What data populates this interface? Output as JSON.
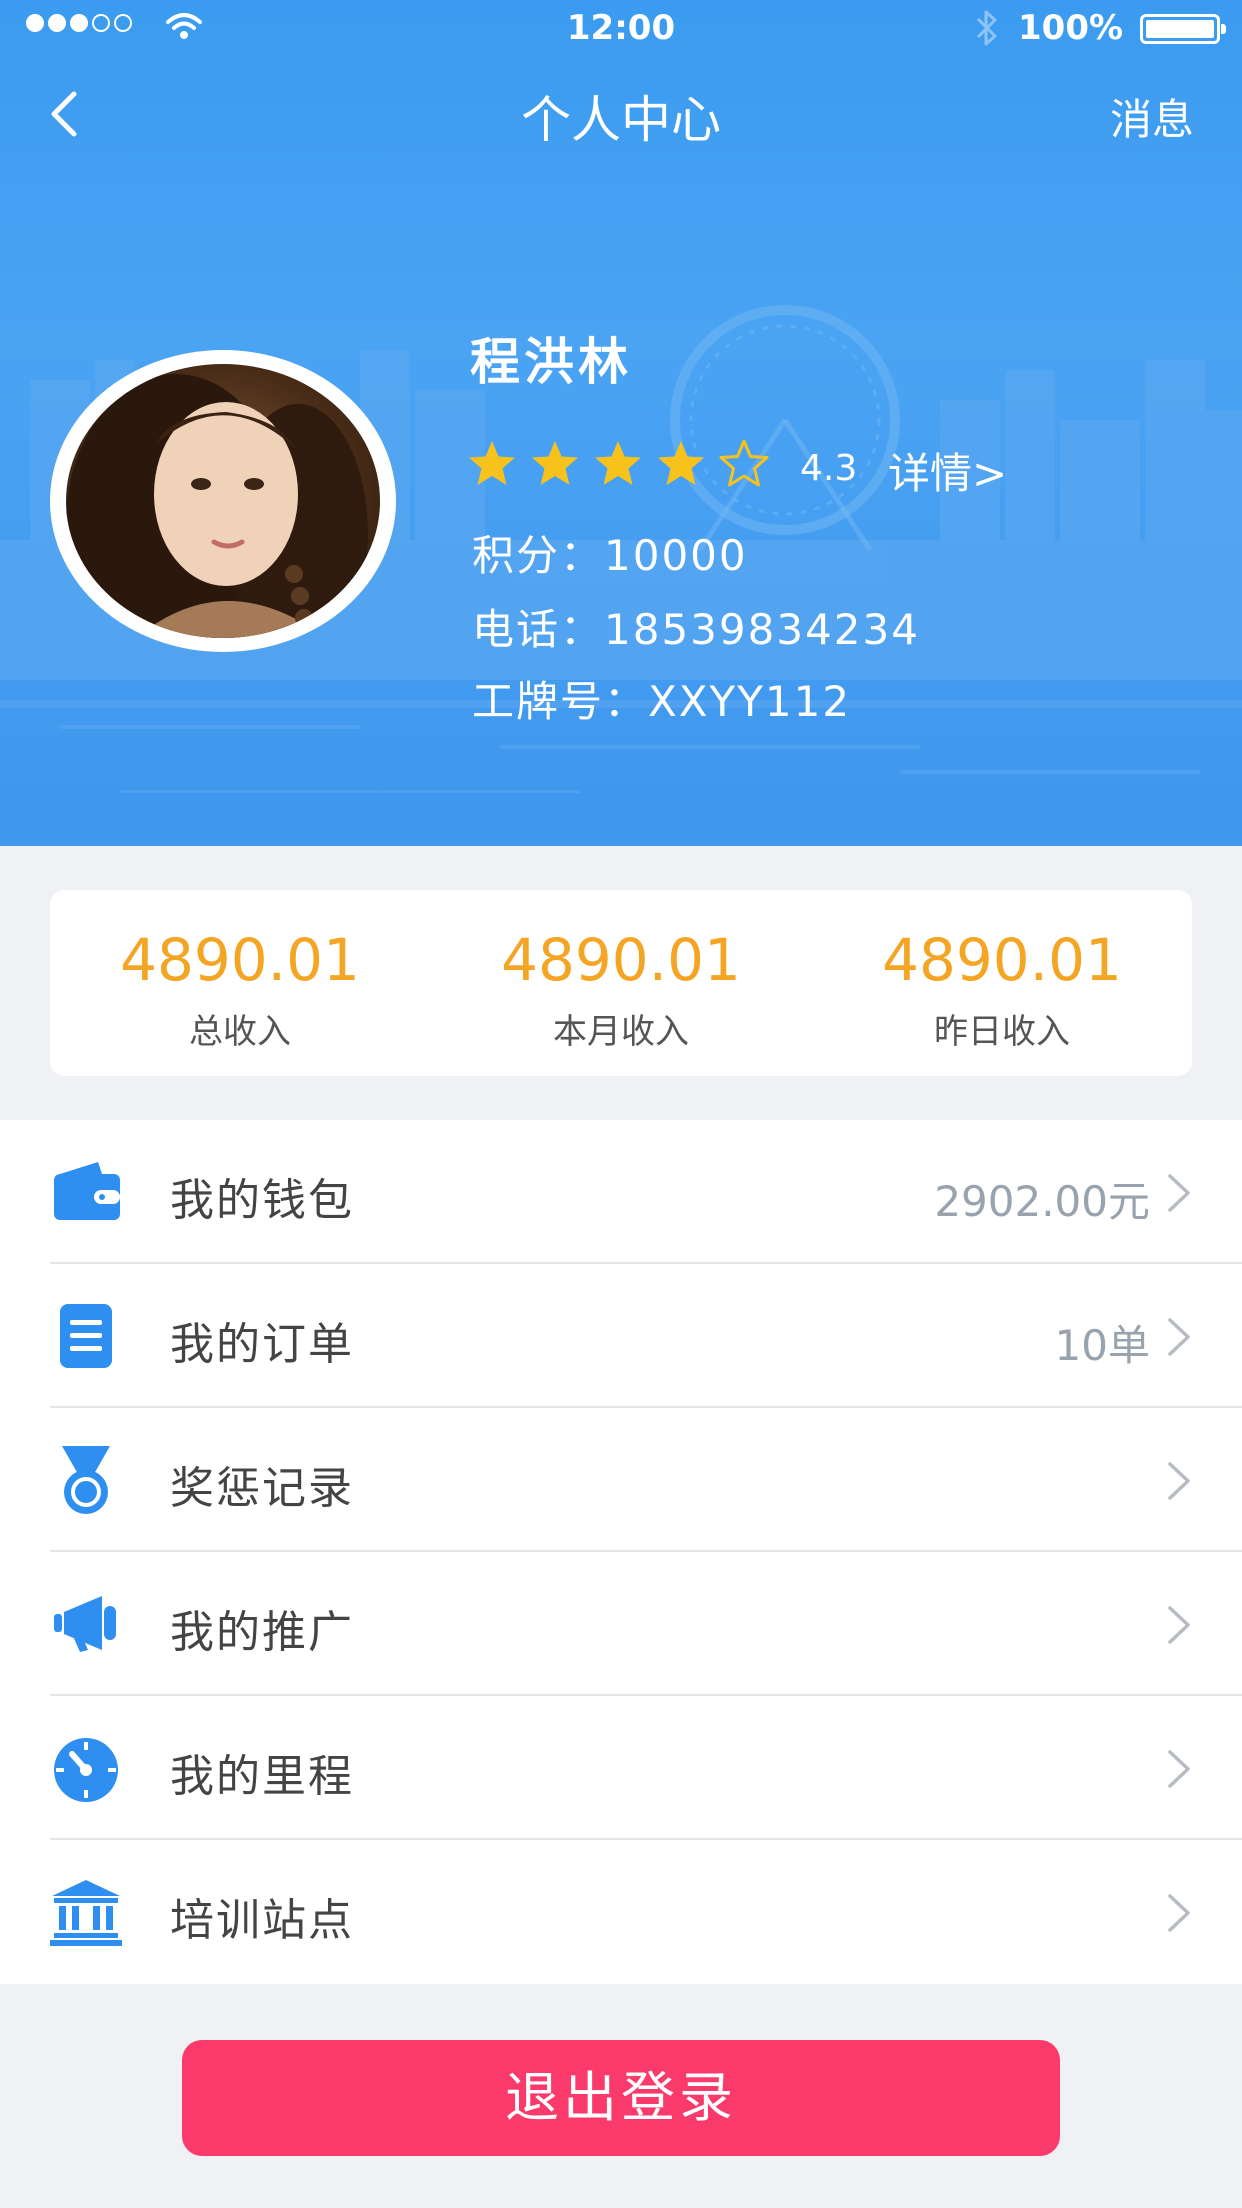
{
  "status_bar": {
    "time": "12:00",
    "battery": "100%"
  },
  "nav": {
    "title": "个人中心",
    "message": "消息"
  },
  "profile": {
    "name": "程洪林",
    "rating": "4.3",
    "rating_stars": 4,
    "rating_max": 5,
    "detail_link": "详情>",
    "points_label": "积分：",
    "points_value": "10000",
    "phone_label": "电话：",
    "phone_value": "18539834234",
    "badge_label": "工牌号：",
    "badge_value": "XXYY112"
  },
  "income": [
    {
      "value": "4890.01",
      "label": "总收入"
    },
    {
      "value": "4890.01",
      "label": "本月收入"
    },
    {
      "value": "4890.01",
      "label": "昨日收入"
    }
  ],
  "menu": [
    {
      "icon": "wallet-icon",
      "label": "我的钱包",
      "value": "2902.00元"
    },
    {
      "icon": "order-list-icon",
      "label": "我的订单",
      "value": "10单"
    },
    {
      "icon": "medal-icon",
      "label": "奖惩记录",
      "value": ""
    },
    {
      "icon": "megaphone-icon",
      "label": "我的推广",
      "value": ""
    },
    {
      "icon": "speedometer-icon",
      "label": "我的里程",
      "value": ""
    },
    {
      "icon": "bank-building-icon",
      "label": "培训站点",
      "value": ""
    }
  ],
  "logout_label": "退出登录",
  "colors": {
    "primary_blue": "#3f9bf0",
    "income_orange": "#f5a524",
    "star_yellow": "#f8c21c",
    "logout_pink": "#fb3a6c",
    "icon_blue": "#2f8ff0"
  }
}
